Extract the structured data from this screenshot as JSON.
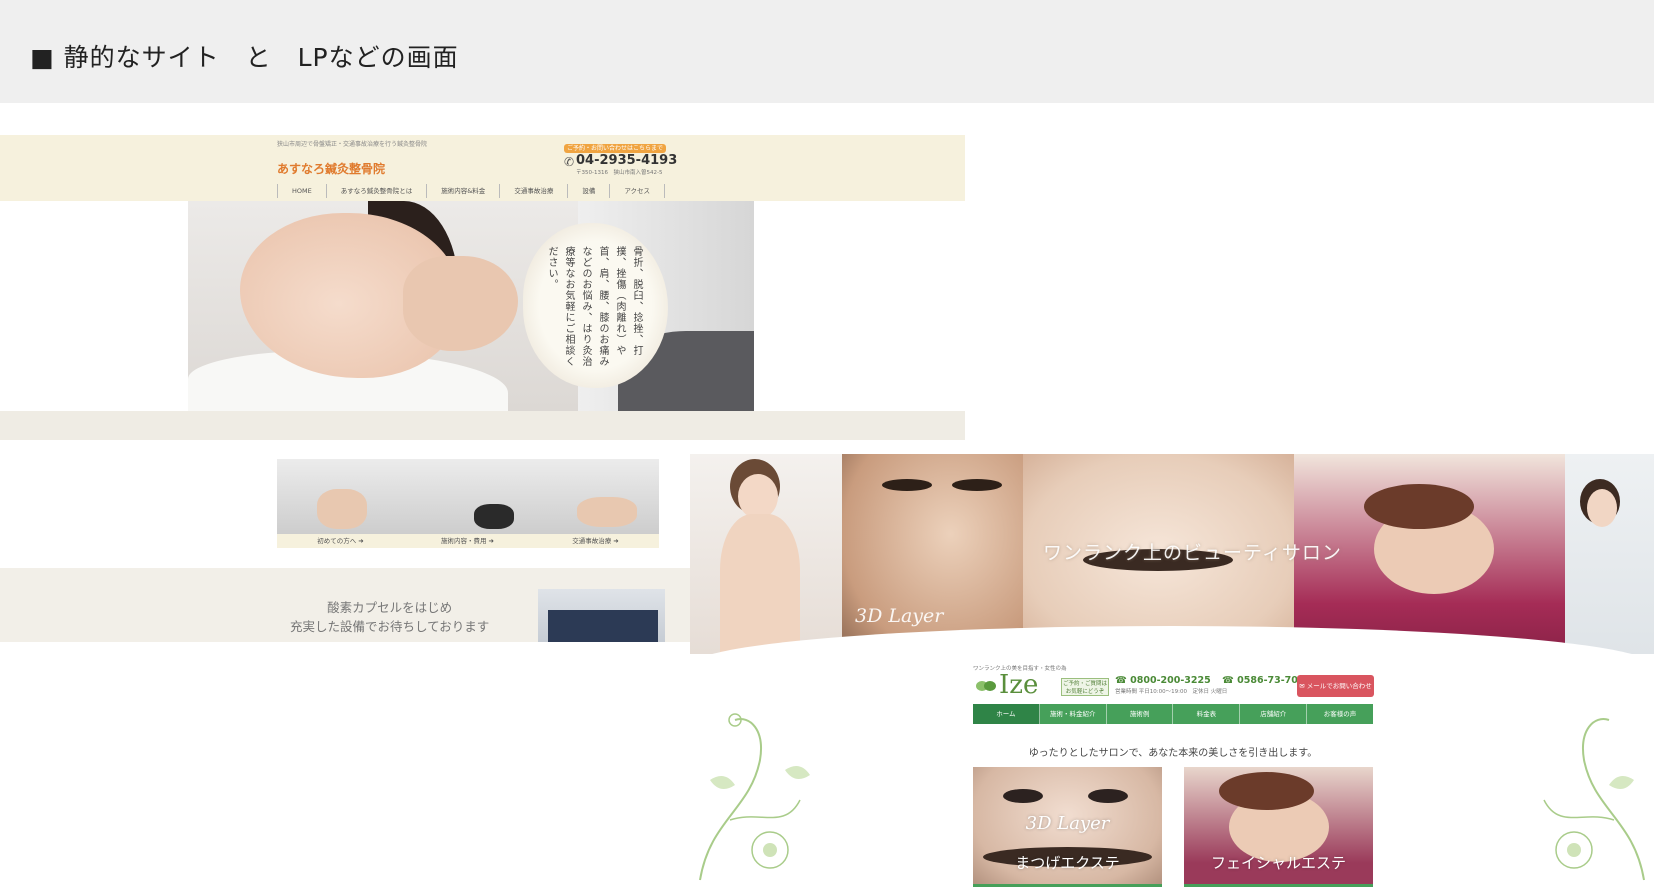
{
  "page": {
    "title": "■ 静的なサイト　と　LPなどの画面"
  },
  "clinic": {
    "tagline": "狭山市周辺で骨盤矯正・交通事故治療を行う鍼灸整骨院",
    "logo": "あすなろ鍼灸整骨院",
    "cta": "ご予約・お問い合わせはこちらまで",
    "phone": "04-2935-4193",
    "address": "〒350-1316　狭山市南入曽542-5",
    "nav": [
      "HOME",
      "あすなろ鍼灸整骨院とは",
      "施術内容&料金",
      "交通事故治療",
      "設備",
      "アクセス"
    ],
    "hero_copy": "骨折、脱臼、捻挫、打撲、挫傷（肉離れ）や首、肩、腰、膝のお痛みなどのお悩み、はり灸治療等なお気軽にご相談ください。",
    "features": [
      "初めての方へ ➜",
      "施術内容・費用 ➜",
      "交通事故治療 ➜"
    ],
    "equipment_lines": [
      "酸素カプセルをはじめ",
      "充実した設備でお待ちしております"
    ]
  },
  "salon": {
    "hero_caption": "ワンランク上のビューティサロン",
    "hero_brand": "3D Layer",
    "tagline": "ワンランク上の美を目指す・女性の為",
    "logo": "Ize",
    "info_tag": "ご予約・ご質問は お気軽にどうぞ",
    "phone1": "☎ 0800-200-3225",
    "phone2": "☎ 0586-73-7031",
    "hours": "営業時間 平日10:00〜19:00　定休日 火曜日",
    "reserve": "✉ メールでお問い合わせ",
    "nav": [
      "ホーム",
      "施術・料金紹介",
      "施術例",
      "料金表",
      "店舗紹介",
      "お客様の声"
    ],
    "lead": "ゆったりとしたサロンで、あなた本来の美しさを引き出します。",
    "cards": [
      {
        "script": "3D Layer",
        "title": "まつげエクステ"
      },
      {
        "script": "",
        "title": "フェイシャルエステ"
      }
    ]
  },
  "colors": {
    "header_band": "#efefef",
    "clinic_accent": "#e07b2e",
    "salon_green": "#46a05a",
    "salon_red": "#d9555f"
  },
  "icons": [
    "phone-icon",
    "leaf-logo-icon",
    "mail-icon",
    "floral-ornament-icon"
  ]
}
